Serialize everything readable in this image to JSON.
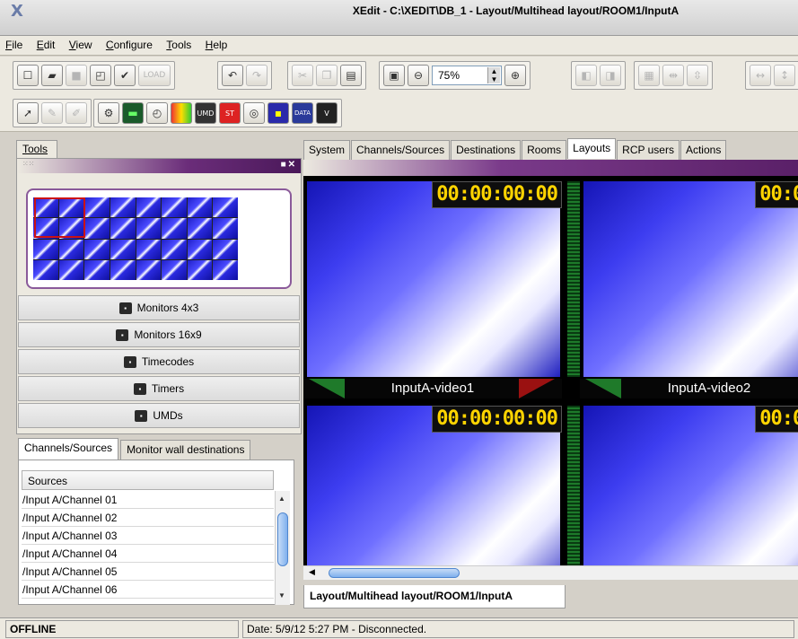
{
  "window": {
    "title": "XEdit - C:\\XEDIT\\DB_1 - Layout/Multihead layout/ROOM1/InputA",
    "app_icon": "X"
  },
  "menu": [
    "File",
    "Edit",
    "View",
    "Configure",
    "Tools",
    "Help"
  ],
  "toolbar": {
    "zoom_value": "75%",
    "load_label": "LOAD"
  },
  "tools_tab": "Tools",
  "tool_items": [
    "Monitors 4x3",
    "Monitors 16x9",
    "Timecodes",
    "Timers",
    "UMDs"
  ],
  "left_tabs": [
    "Channels/Sources",
    "Monitor wall destinations"
  ],
  "sources": {
    "header": "Sources",
    "rows": [
      "/Input A/Channel 01",
      "/Input A/Channel 02",
      "/Input A/Channel 03",
      "/Input A/Channel 04",
      "/Input A/Channel 05",
      "/Input A/Channel 06"
    ]
  },
  "main_tabs": [
    "System",
    "Channels/Sources",
    "Destinations",
    "Rooms",
    "Layouts",
    "RCP users",
    "Actions"
  ],
  "canvas": {
    "timecode": "00:00:00:00",
    "tiles": [
      "InputA-video1",
      "InputA-video2"
    ]
  },
  "doc_tab": "Layout/Multihead layout/ROOM1/InputA",
  "status": {
    "state": "OFFLINE",
    "message": "Date: 5/9/12 5:27 PM - Disconnected."
  }
}
